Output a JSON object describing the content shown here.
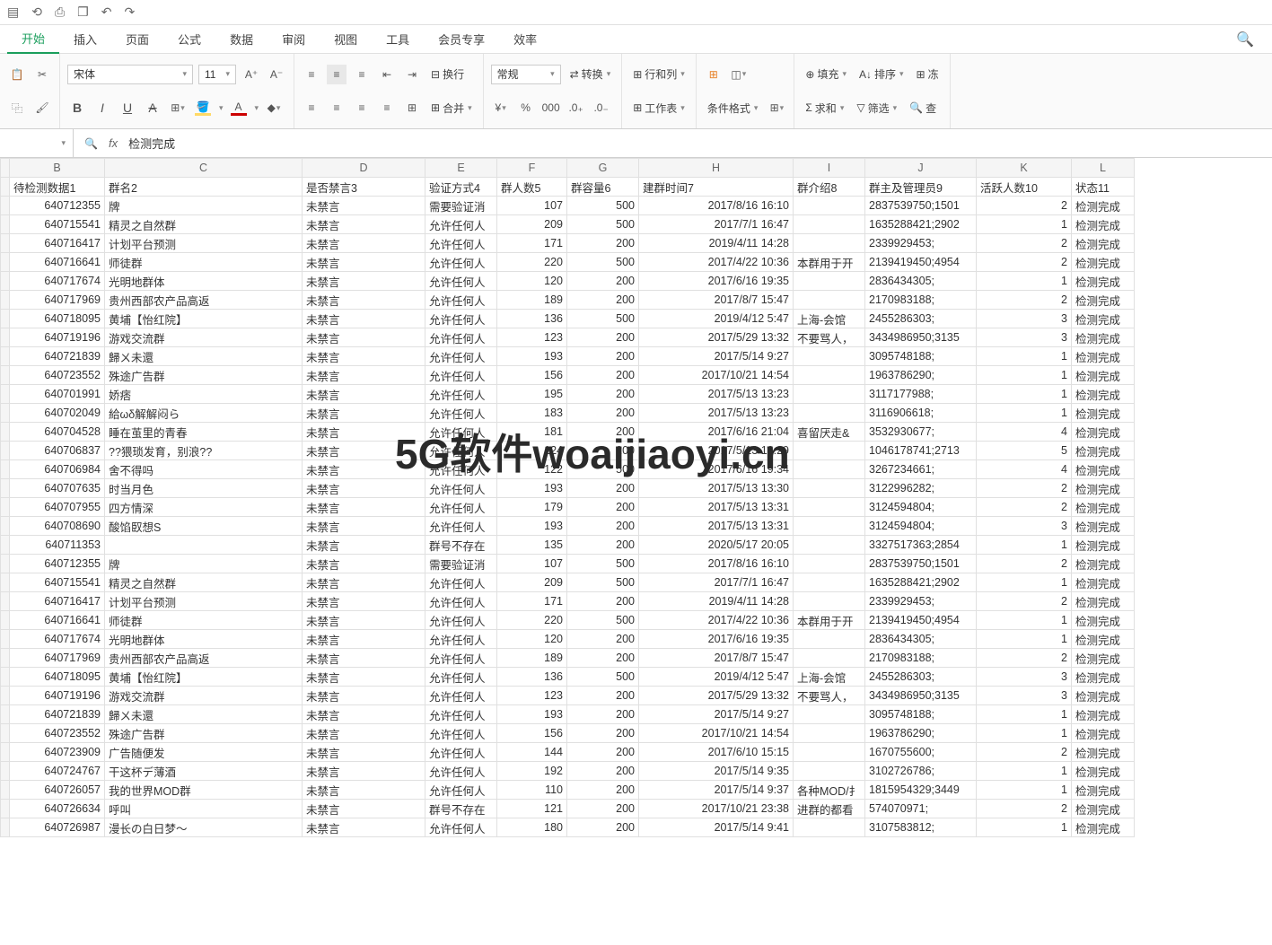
{
  "menu": {
    "tabs": [
      "开始",
      "插入",
      "页面",
      "公式",
      "数据",
      "审阅",
      "视图",
      "工具",
      "会员专享",
      "效率"
    ],
    "activeIndex": 0
  },
  "ribbon": {
    "font_name": "宋体",
    "font_size": "11",
    "convert": "转换",
    "rowcol": "行和列",
    "worksheet": "工作表",
    "cond_format": "条件格式",
    "wrap": "换行",
    "merge": "合并",
    "number_format": "常规",
    "fill": "填充",
    "sort": "排序",
    "freeze": "冻",
    "sum": "求和",
    "filter": "筛选",
    "find": "查"
  },
  "formula_bar": {
    "value": "检测完成"
  },
  "columns": [
    "B",
    "C",
    "D",
    "E",
    "F",
    "G",
    "H",
    "I",
    "J",
    "K",
    "L"
  ],
  "headers": {
    "B": "待检测数据1",
    "C": "群名2",
    "D": "是否禁言3",
    "E": "验证方式4",
    "F": "群人数5",
    "G": "群容量6",
    "H": "建群时间7",
    "I": "群介绍8",
    "J": "群主及管理员9",
    "K": "活跃人数10",
    "L": "状态11"
  },
  "rows": [
    {
      "B": "640712355",
      "C": "牌",
      "D": "未禁言",
      "E": "需要验证消",
      "F": "107",
      "G": "500",
      "H": "2017/8/16 16:10",
      "I": "",
      "J": "2837539750;1501",
      "K": "2",
      "L": "检测完成"
    },
    {
      "B": "640715541",
      "C": "精灵之自然群",
      "D": "未禁言",
      "E": "允许任何人",
      "F": "209",
      "G": "500",
      "H": "2017/7/1 16:47",
      "I": "",
      "J": "1635288421;2902",
      "K": "1",
      "L": "检测完成"
    },
    {
      "B": "640716417",
      "C": "计划平台预测",
      "D": "未禁言",
      "E": "允许任何人",
      "F": "171",
      "G": "200",
      "H": "2019/4/11 14:28",
      "I": "",
      "J": "2339929453;",
      "K": "2",
      "L": "检测完成"
    },
    {
      "B": "640716641",
      "C": "师徒群",
      "D": "未禁言",
      "E": "允许任何人",
      "F": "220",
      "G": "500",
      "H": "2017/4/22 10:36",
      "I": "本群用于开",
      "J": "2139419450;4954",
      "K": "2",
      "L": "检测完成"
    },
    {
      "B": "640717674",
      "C": "光明地群体",
      "D": "未禁言",
      "E": "允许任何人",
      "F": "120",
      "G": "200",
      "H": "2017/6/16 19:35",
      "I": "",
      "J": "2836434305;",
      "K": "1",
      "L": "检测完成"
    },
    {
      "B": "640717969",
      "C": "贵州西部农产品高返",
      "D": "未禁言",
      "E": "允许任何人",
      "F": "189",
      "G": "200",
      "H": "2017/8/7 15:47",
      "I": "",
      "J": "2170983188;",
      "K": "2",
      "L": "检测完成"
    },
    {
      "B": "640718095",
      "C": "黄埔【怡红院】",
      "D": "未禁言",
      "E": "允许任何人",
      "F": "136",
      "G": "500",
      "H": "2019/4/12 5:47",
      "I": "上海-会馆",
      "J": "2455286303;",
      "K": "3",
      "L": "检测完成"
    },
    {
      "B": "640719196",
      "C": "游戏交流群",
      "D": "未禁言",
      "E": "允许任何人",
      "F": "123",
      "G": "200",
      "H": "2017/5/29 13:32",
      "I": "不要骂人，",
      "J": "3434986950;3135",
      "K": "3",
      "L": "检测完成"
    },
    {
      "B": "640721839",
      "C": "歸ㄨ未還",
      "D": "未禁言",
      "E": "允许任何人",
      "F": "193",
      "G": "200",
      "H": "2017/5/14 9:27",
      "I": "",
      "J": "3095748188;",
      "K": "1",
      "L": "检测完成"
    },
    {
      "B": "640723552",
      "C": "殊途广告群",
      "D": "未禁言",
      "E": "允许任何人",
      "F": "156",
      "G": "200",
      "H": "2017/10/21 14:54",
      "I": "",
      "J": "1963786290;",
      "K": "1",
      "L": "检测完成"
    },
    {
      "B": "640701991",
      "C": "娇痞",
      "D": "未禁言",
      "E": "允许任何人",
      "F": "195",
      "G": "200",
      "H": "2017/5/13 13:23",
      "I": "",
      "J": "3117177988;",
      "K": "1",
      "L": "检测完成"
    },
    {
      "B": "640702049",
      "C": "給ωδ解解闷ら",
      "D": "未禁言",
      "E": "允许任何人",
      "F": "183",
      "G": "200",
      "H": "2017/5/13 13:23",
      "I": "",
      "J": "3116906618;",
      "K": "1",
      "L": "检测完成"
    },
    {
      "B": "640704528",
      "C": "睡在茧里的青春",
      "D": "未禁言",
      "E": "允许任何人",
      "F": "181",
      "G": "200",
      "H": "2017/6/16 21:04",
      "I": "喜留厌走&",
      "J": "3532930677;",
      "K": "4",
      "L": "检测完成"
    },
    {
      "B": "640706837",
      "C": "??猥琐发育，别浪??",
      "D": "未禁言",
      "E": "允许任何人",
      "F": "124",
      "G": "200",
      "H": "2017/5/13 13:29",
      "I": "",
      "J": "1046178741;2713",
      "K": "5",
      "L": "检测完成"
    },
    {
      "B": "640706984",
      "C": "舍不得吗",
      "D": "未禁言",
      "E": "允许任何人",
      "F": "122",
      "G": "500",
      "H": "2017/6/16 19:34",
      "I": "",
      "J": "3267234661;",
      "K": "4",
      "L": "检测完成"
    },
    {
      "B": "640707635",
      "C": "时当月色",
      "D": "未禁言",
      "E": "允许任何人",
      "F": "193",
      "G": "200",
      "H": "2017/5/13 13:30",
      "I": "",
      "J": "3122996282;",
      "K": "2",
      "L": "检测完成"
    },
    {
      "B": "640707955",
      "C": "四方情深",
      "D": "未禁言",
      "E": "允许任何人",
      "F": "179",
      "G": "200",
      "H": "2017/5/13 13:31",
      "I": "",
      "J": "3124594804;",
      "K": "2",
      "L": "检测完成"
    },
    {
      "B": "640708690",
      "C": "酸馅臤想S",
      "D": "未禁言",
      "E": "允许任何人",
      "F": "193",
      "G": "200",
      "H": "2017/5/13 13:31",
      "I": "",
      "J": "3124594804;",
      "K": "3",
      "L": "检测完成"
    },
    {
      "B": "640711353",
      "C": "",
      "D": "未禁言",
      "E": "群号不存在",
      "F": "135",
      "G": "200",
      "H": "2020/5/17 20:05",
      "I": "",
      "J": "3327517363;2854",
      "K": "1",
      "L": "检测完成"
    },
    {
      "B": "640712355",
      "C": "牌",
      "D": "未禁言",
      "E": "需要验证消",
      "F": "107",
      "G": "500",
      "H": "2017/8/16 16:10",
      "I": "",
      "J": "2837539750;1501",
      "K": "2",
      "L": "检测完成"
    },
    {
      "B": "640715541",
      "C": "精灵之自然群",
      "D": "未禁言",
      "E": "允许任何人",
      "F": "209",
      "G": "500",
      "H": "2017/7/1 16:47",
      "I": "",
      "J": "1635288421;2902",
      "K": "1",
      "L": "检测完成"
    },
    {
      "B": "640716417",
      "C": "计划平台预测",
      "D": "未禁言",
      "E": "允许任何人",
      "F": "171",
      "G": "200",
      "H": "2019/4/11 14:28",
      "I": "",
      "J": "2339929453;",
      "K": "2",
      "L": "检测完成"
    },
    {
      "B": "640716641",
      "C": "师徒群",
      "D": "未禁言",
      "E": "允许任何人",
      "F": "220",
      "G": "500",
      "H": "2017/4/22 10:36",
      "I": "本群用于开",
      "J": "2139419450;4954",
      "K": "1",
      "L": "检测完成"
    },
    {
      "B": "640717674",
      "C": "光明地群体",
      "D": "未禁言",
      "E": "允许任何人",
      "F": "120",
      "G": "200",
      "H": "2017/6/16 19:35",
      "I": "",
      "J": "2836434305;",
      "K": "1",
      "L": "检测完成"
    },
    {
      "B": "640717969",
      "C": "贵州西部农产品高返",
      "D": "未禁言",
      "E": "允许任何人",
      "F": "189",
      "G": "200",
      "H": "2017/8/7 15:47",
      "I": "",
      "J": "2170983188;",
      "K": "2",
      "L": "检测完成"
    },
    {
      "B": "640718095",
      "C": "黄埔【怡红院】",
      "D": "未禁言",
      "E": "允许任何人",
      "F": "136",
      "G": "500",
      "H": "2019/4/12 5:47",
      "I": "上海-会馆",
      "J": "2455286303;",
      "K": "3",
      "L": "检测完成"
    },
    {
      "B": "640719196",
      "C": "游戏交流群",
      "D": "未禁言",
      "E": "允许任何人",
      "F": "123",
      "G": "200",
      "H": "2017/5/29 13:32",
      "I": "不要骂人，",
      "J": "3434986950;3135",
      "K": "3",
      "L": "检测完成"
    },
    {
      "B": "640721839",
      "C": "歸ㄨ未還",
      "D": "未禁言",
      "E": "允许任何人",
      "F": "193",
      "G": "200",
      "H": "2017/5/14 9:27",
      "I": "",
      "J": "3095748188;",
      "K": "1",
      "L": "检测完成"
    },
    {
      "B": "640723552",
      "C": "殊途广告群",
      "D": "未禁言",
      "E": "允许任何人",
      "F": "156",
      "G": "200",
      "H": "2017/10/21 14:54",
      "I": "",
      "J": "1963786290;",
      "K": "1",
      "L": "检测完成"
    },
    {
      "B": "640723909",
      "C": "广告随便发",
      "D": "未禁言",
      "E": "允许任何人",
      "F": "144",
      "G": "200",
      "H": "2017/6/10 15:15",
      "I": "",
      "J": "1670755600;",
      "K": "2",
      "L": "检测完成"
    },
    {
      "B": "640724767",
      "C": "干这杯デ薄酒",
      "D": "未禁言",
      "E": "允许任何人",
      "F": "192",
      "G": "200",
      "H": "2017/5/14 9:35",
      "I": "",
      "J": "3102726786;",
      "K": "1",
      "L": "检测完成"
    },
    {
      "B": "640726057",
      "C": "我的世界MOD群",
      "D": "未禁言",
      "E": "允许任何人",
      "F": "110",
      "G": "200",
      "H": "2017/5/14 9:37",
      "I": "各种MOD/扌",
      "J": "1815954329;3449",
      "K": "1",
      "L": "检测完成"
    },
    {
      "B": "640726634",
      "C": "呼叫",
      "D": "未禁言",
      "E": "群号不存在",
      "F": "121",
      "G": "200",
      "H": "2017/10/21 23:38",
      "I": "进群的都看",
      "J": "574070971;",
      "K": "2",
      "L": "检测完成"
    },
    {
      "B": "640726987",
      "C": "漫长の白日梦〜",
      "D": "未禁言",
      "E": "允许任何人",
      "F": "180",
      "G": "200",
      "H": "2017/5/14 9:41",
      "I": "",
      "J": "3107583812;",
      "K": "1",
      "L": "检测完成"
    }
  ],
  "watermark": "5G软件woaijiaoyi.cn"
}
